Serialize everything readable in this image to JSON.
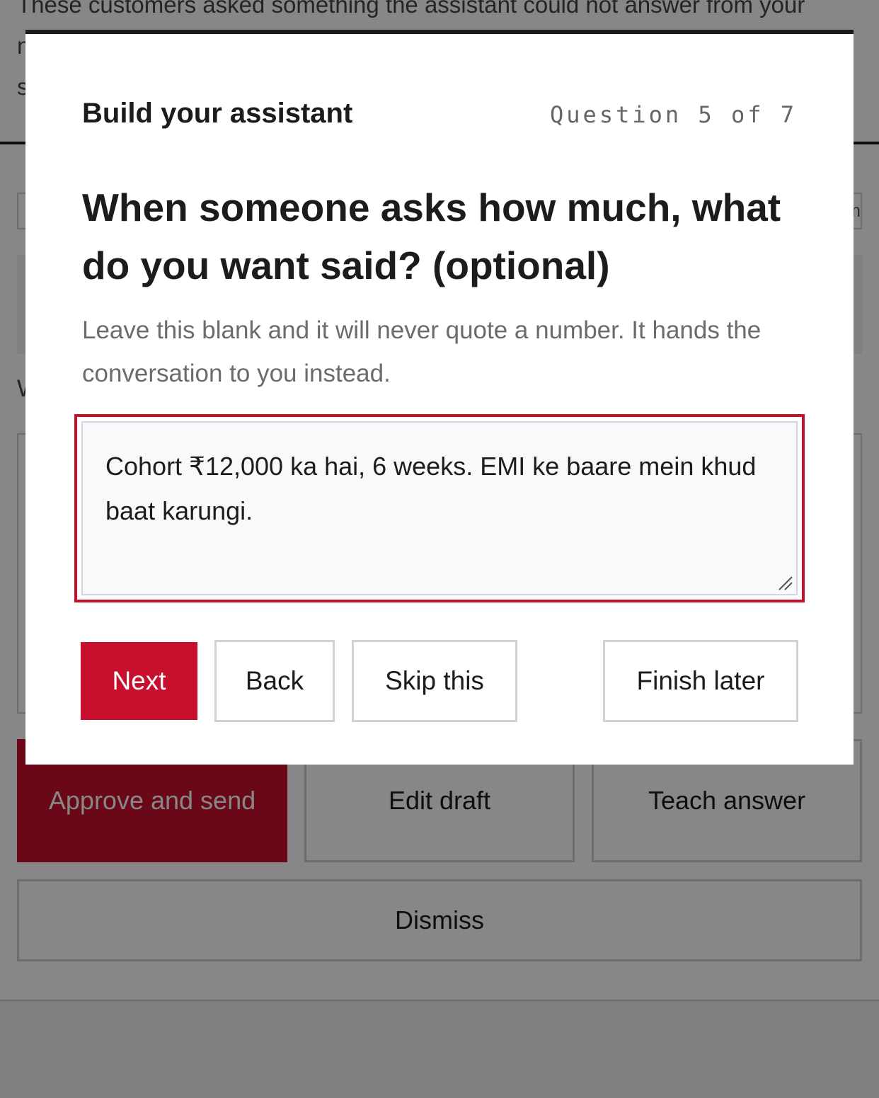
{
  "background": {
    "intro_text": "These customers asked something the assistant could not answer from your notes. Review each one before it goes out to the customer, you decide what is said in the end.",
    "field_tail": "m",
    "question_label": "W",
    "actions": {
      "approve_label": "Approve and send",
      "edit_label": "Edit draft",
      "teach_label": "Teach answer",
      "dismiss_label": "Dismiss"
    }
  },
  "modal": {
    "title": "Build your assistant",
    "step_counter": "Question 5 of 7",
    "question": "When someone asks how much, what do you want said? (optional)",
    "help_text": "Leave this blank and it will never quote a number. It hands the conversation to you instead.",
    "answer_value": "Cohort ₹12,000 ka hai, 6 weeks. EMI ke baare mein khud baat karungi.",
    "buttons": {
      "next": "Next",
      "back": "Back",
      "skip": "Skip this",
      "finish_later": "Finish later"
    }
  },
  "colors": {
    "accent": "#c8102e",
    "ink": "#1c1c1c",
    "muted": "#6b6b6b"
  }
}
